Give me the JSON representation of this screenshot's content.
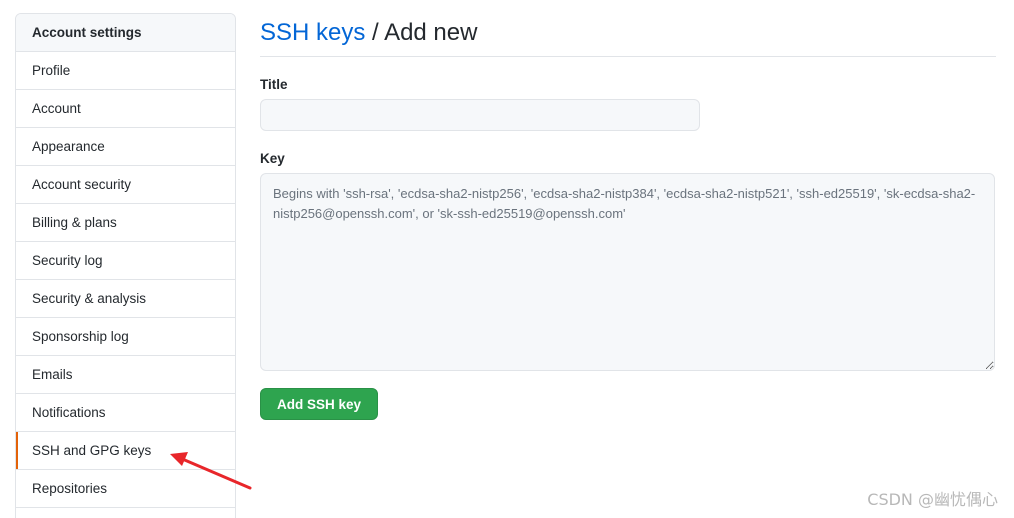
{
  "sidebar": {
    "header": "Account settings",
    "items": [
      {
        "label": "Profile"
      },
      {
        "label": "Account"
      },
      {
        "label": "Appearance"
      },
      {
        "label": "Account security"
      },
      {
        "label": "Billing & plans"
      },
      {
        "label": "Security log"
      },
      {
        "label": "Security & analysis"
      },
      {
        "label": "Sponsorship log"
      },
      {
        "label": "Emails"
      },
      {
        "label": "Notifications"
      },
      {
        "label": "SSH and GPG keys",
        "selected": true
      },
      {
        "label": "Repositories"
      }
    ]
  },
  "main": {
    "breadcrumb_link": "SSH keys",
    "breadcrumb_sep": " / ",
    "breadcrumb_current": "Add new",
    "title_label": "Title",
    "title_value": "",
    "key_label": "Key",
    "key_placeholder": "Begins with 'ssh-rsa', 'ecdsa-sha2-nistp256', 'ecdsa-sha2-nistp384', 'ecdsa-sha2-nistp521', 'ssh-ed25519', 'sk-ecdsa-sha2-nistp256@openssh.com', or 'sk-ssh-ed25519@openssh.com'",
    "add_button": "Add SSH key"
  },
  "annotation": {
    "arrow_color": "#e8262a",
    "arrow_icon": "red-arrow-icon"
  },
  "watermark": "CSDN @幽忧偶心",
  "colors": {
    "link": "#0366d6",
    "primary_button": "#2ea44f",
    "selected_indicator": "#e36209"
  }
}
